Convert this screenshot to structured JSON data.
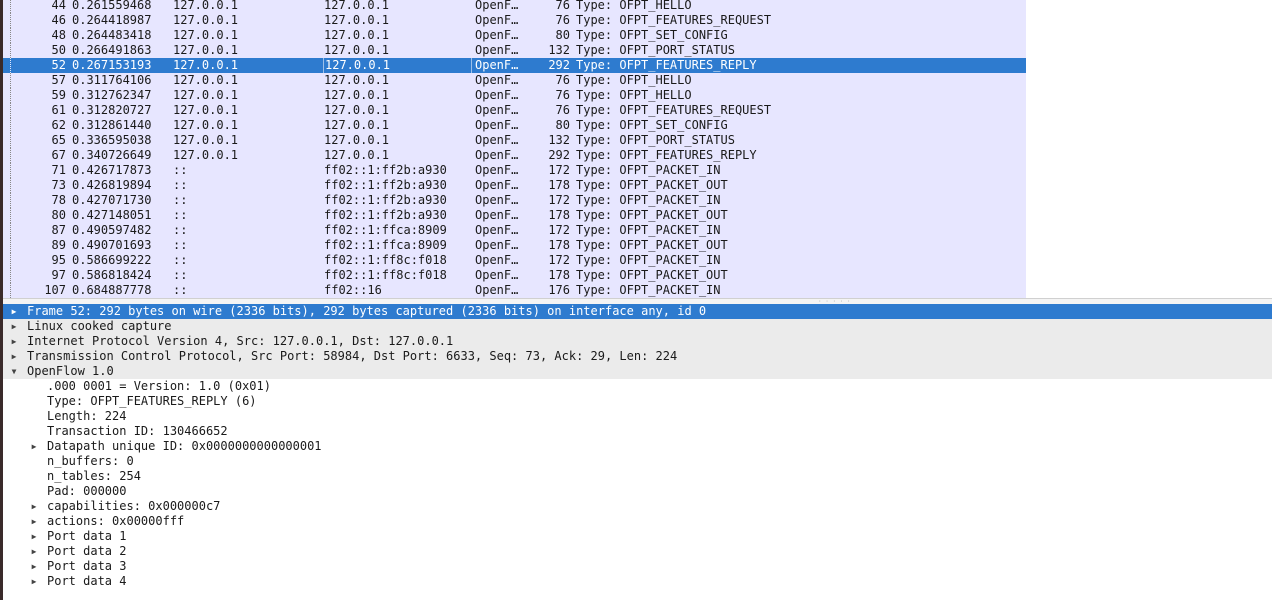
{
  "packets": [
    {
      "no": "44",
      "time": "0.261559468",
      "src": "127.0.0.1",
      "dst": "127.0.0.1",
      "proto": "OpenF…",
      "len": "76",
      "info": "Type: OFPT_HELLO"
    },
    {
      "no": "46",
      "time": "0.264418987",
      "src": "127.0.0.1",
      "dst": "127.0.0.1",
      "proto": "OpenF…",
      "len": "76",
      "info": "Type: OFPT_FEATURES_REQUEST"
    },
    {
      "no": "48",
      "time": "0.264483418",
      "src": "127.0.0.1",
      "dst": "127.0.0.1",
      "proto": "OpenF…",
      "len": "80",
      "info": "Type: OFPT_SET_CONFIG"
    },
    {
      "no": "50",
      "time": "0.266491863",
      "src": "127.0.0.1",
      "dst": "127.0.0.1",
      "proto": "OpenF…",
      "len": "132",
      "info": "Type: OFPT_PORT_STATUS"
    },
    {
      "no": "52",
      "time": "0.267153193",
      "src": "127.0.0.1",
      "dst": "127.0.0.1",
      "proto": "OpenF…",
      "len": "292",
      "info": "Type: OFPT_FEATURES_REPLY",
      "selected": true
    },
    {
      "no": "57",
      "time": "0.311764106",
      "src": "127.0.0.1",
      "dst": "127.0.0.1",
      "proto": "OpenF…",
      "len": "76",
      "info": "Type: OFPT_HELLO"
    },
    {
      "no": "59",
      "time": "0.312762347",
      "src": "127.0.0.1",
      "dst": "127.0.0.1",
      "proto": "OpenF…",
      "len": "76",
      "info": "Type: OFPT_HELLO"
    },
    {
      "no": "61",
      "time": "0.312820727",
      "src": "127.0.0.1",
      "dst": "127.0.0.1",
      "proto": "OpenF…",
      "len": "76",
      "info": "Type: OFPT_FEATURES_REQUEST"
    },
    {
      "no": "62",
      "time": "0.312861440",
      "src": "127.0.0.1",
      "dst": "127.0.0.1",
      "proto": "OpenF…",
      "len": "80",
      "info": "Type: OFPT_SET_CONFIG"
    },
    {
      "no": "65",
      "time": "0.336595038",
      "src": "127.0.0.1",
      "dst": "127.0.0.1",
      "proto": "OpenF…",
      "len": "132",
      "info": "Type: OFPT_PORT_STATUS"
    },
    {
      "no": "67",
      "time": "0.340726649",
      "src": "127.0.0.1",
      "dst": "127.0.0.1",
      "proto": "OpenF…",
      "len": "292",
      "info": "Type: OFPT_FEATURES_REPLY"
    },
    {
      "no": "71",
      "time": "0.426717873",
      "src": "::",
      "dst": "ff02::1:ff2b:a930",
      "proto": "OpenF…",
      "len": "172",
      "info": "Type: OFPT_PACKET_IN"
    },
    {
      "no": "73",
      "time": "0.426819894",
      "src": "::",
      "dst": "ff02::1:ff2b:a930",
      "proto": "OpenF…",
      "len": "178",
      "info": "Type: OFPT_PACKET_OUT"
    },
    {
      "no": "78",
      "time": "0.427071730",
      "src": "::",
      "dst": "ff02::1:ff2b:a930",
      "proto": "OpenF…",
      "len": "172",
      "info": "Type: OFPT_PACKET_IN"
    },
    {
      "no": "80",
      "time": "0.427148051",
      "src": "::",
      "dst": "ff02::1:ff2b:a930",
      "proto": "OpenF…",
      "len": "178",
      "info": "Type: OFPT_PACKET_OUT"
    },
    {
      "no": "87",
      "time": "0.490597482",
      "src": "::",
      "dst": "ff02::1:ffca:8909",
      "proto": "OpenF…",
      "len": "172",
      "info": "Type: OFPT_PACKET_IN"
    },
    {
      "no": "89",
      "time": "0.490701693",
      "src": "::",
      "dst": "ff02::1:ffca:8909",
      "proto": "OpenF…",
      "len": "178",
      "info": "Type: OFPT_PACKET_OUT"
    },
    {
      "no": "95",
      "time": "0.586699222",
      "src": "::",
      "dst": "ff02::1:ff8c:f018",
      "proto": "OpenF…",
      "len": "172",
      "info": "Type: OFPT_PACKET_IN"
    },
    {
      "no": "97",
      "time": "0.586818424",
      "src": "::",
      "dst": "ff02::1:ff8c:f018",
      "proto": "OpenF…",
      "len": "178",
      "info": "Type: OFPT_PACKET_OUT"
    },
    {
      "no": "107",
      "time": "0.684887778",
      "src": "::",
      "dst": "ff02::16",
      "proto": "OpenF…",
      "len": "176",
      "info": "Type: OFPT_PACKET_IN"
    }
  ],
  "details": [
    {
      "level": 0,
      "expander": "collapsed",
      "text": "Frame 52: 292 bytes on wire (2336 bits), 292 bytes captured (2336 bits) on interface any, id 0",
      "selected": true
    },
    {
      "level": 0,
      "expander": "collapsed",
      "text": "Linux cooked capture"
    },
    {
      "level": 0,
      "expander": "collapsed",
      "text": "Internet Protocol Version 4, Src: 127.0.0.1, Dst: 127.0.0.1"
    },
    {
      "level": 0,
      "expander": "collapsed",
      "text": "Transmission Control Protocol, Src Port: 58984, Dst Port: 6633, Seq: 73, Ack: 29, Len: 224"
    },
    {
      "level": 0,
      "expander": "expanded",
      "text": "OpenFlow 1.0"
    },
    {
      "level": 1,
      "expander": "none",
      "text": ".000 0001 = Version: 1.0 (0x01)"
    },
    {
      "level": 1,
      "expander": "none",
      "text": "Type: OFPT_FEATURES_REPLY (6)"
    },
    {
      "level": 1,
      "expander": "none",
      "text": "Length: 224"
    },
    {
      "level": 1,
      "expander": "none",
      "text": "Transaction ID: 130466652"
    },
    {
      "level": 1,
      "expander": "collapsed",
      "text": "Datapath unique ID: 0x0000000000000001"
    },
    {
      "level": 1,
      "expander": "none",
      "text": "n_buffers: 0"
    },
    {
      "level": 1,
      "expander": "none",
      "text": "n_tables: 254"
    },
    {
      "level": 1,
      "expander": "none",
      "text": "Pad: 000000"
    },
    {
      "level": 1,
      "expander": "collapsed",
      "text": "capabilities: 0x000000c7"
    },
    {
      "level": 1,
      "expander": "collapsed",
      "text": "actions: 0x00000fff"
    },
    {
      "level": 1,
      "expander": "collapsed",
      "text": "Port data 1"
    },
    {
      "level": 1,
      "expander": "collapsed",
      "text": "Port data 2"
    },
    {
      "level": 1,
      "expander": "collapsed",
      "text": "Port data 3"
    },
    {
      "level": 1,
      "expander": "collapsed",
      "text": "Port data 4"
    }
  ],
  "icons": {
    "collapsed": "triangle-right-icon",
    "expanded": "triangle-down-icon"
  },
  "colors": {
    "row_bg": "#e7e6ff",
    "selected_bg": "#2e7bcf",
    "selected_fg": "#ffffff"
  }
}
